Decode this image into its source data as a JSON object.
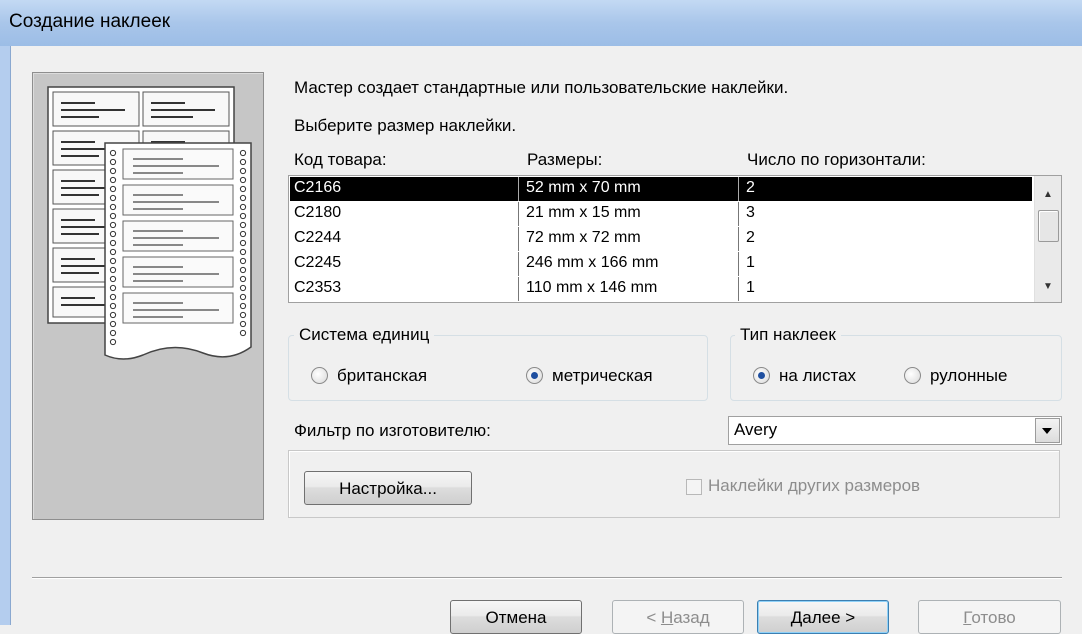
{
  "window": {
    "title": "Создание наклеек"
  },
  "intro": {
    "line1": "Мастер создает стандартные или пользовательские наклейки.",
    "line2": "Выберите размер наклейки."
  },
  "columns": {
    "code": "Код товара:",
    "size": "Размеры:",
    "across": "Число по горизонтали:"
  },
  "labels": [
    {
      "code": "C2166",
      "size": "52 mm x 70 mm",
      "across": "2",
      "selected": true
    },
    {
      "code": "C2180",
      "size": "21 mm x 15 mm",
      "across": "3"
    },
    {
      "code": "C2244",
      "size": "72 mm x 72 mm",
      "across": "2"
    },
    {
      "code": "C2245",
      "size": "246 mm x 166 mm",
      "across": "1"
    },
    {
      "code": "C2353",
      "size": "110 mm x 146 mm",
      "across": "1"
    }
  ],
  "units": {
    "label": "Система единиц",
    "options": [
      "британская",
      "метрическая"
    ],
    "selected": "метрическая"
  },
  "label_type": {
    "label": "Тип наклеек",
    "options": [
      "на листах",
      "рулонные"
    ],
    "selected": "на листах"
  },
  "filter": {
    "label": "Фильтр по изготовителю:",
    "value": "Avery"
  },
  "customize": {
    "button": "Настройка...",
    "other_sizes_checkbox": "Наклейки других размеров",
    "other_sizes_checked": false
  },
  "buttons": {
    "cancel": "Отмена",
    "back_prefix": "< ",
    "back_accel": "Н",
    "back_rest": "азад",
    "next_accel": "Д",
    "next_rest": "алее >",
    "finish_accel": "Г",
    "finish_rest": "отово"
  }
}
